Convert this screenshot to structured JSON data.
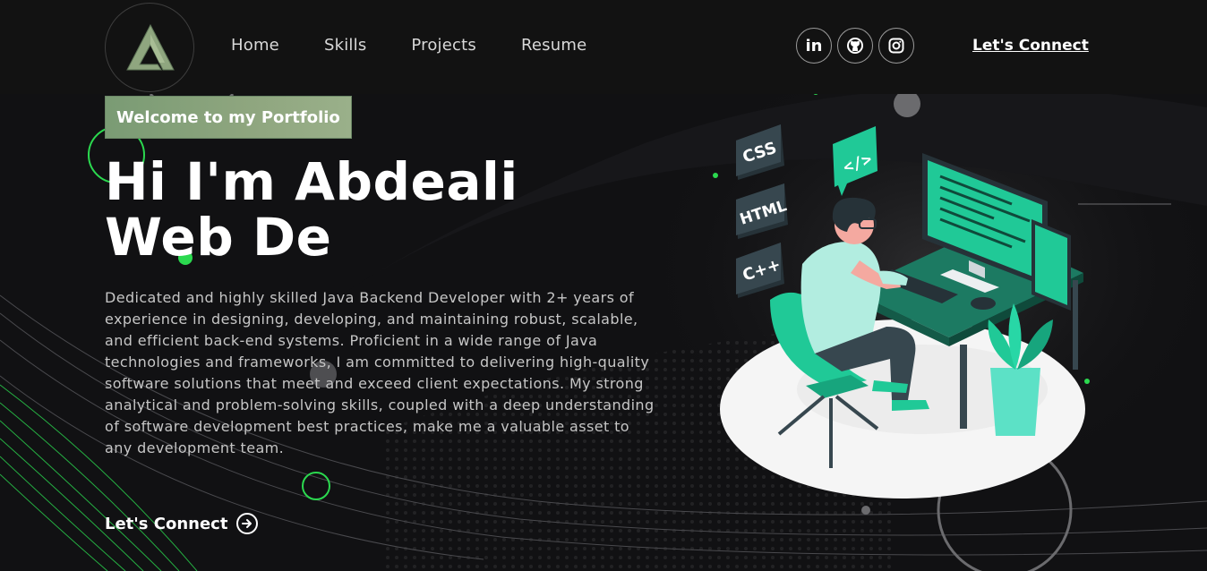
{
  "brand": {
    "logo_icon": "triangle-a-logo-icon"
  },
  "nav": {
    "links": [
      "Home",
      "Skills",
      "Projects",
      "Resume"
    ],
    "social": [
      {
        "label": "in",
        "icon": "linkedin-icon"
      },
      {
        "label": "",
        "icon": "github-icon"
      },
      {
        "label": "",
        "icon": "instagram-icon"
      }
    ],
    "cta": "Let's Connect"
  },
  "hero": {
    "tagline": "Welcome to my Portfolio",
    "headline_line1": "Hi I'm Abdeali",
    "headline_line2": "Web De",
    "description": "Dedicated and highly skilled Java Backend Developer with 2+ years of experience in designing, developing, and maintaining robust, scalable, and efficient back-end systems. Proficient in a wide range of Java technologies and frameworks, I am committed to delivering high-quality software solutions that meet and exceed client expectations. My strong analytical and problem-solving skills, coupled with a deep understanding of software development best practices, make me a valuable asset to any development team.",
    "cta": "Let's Connect",
    "cta_icon": "arrow-right-circle-icon"
  },
  "illustration": {
    "badges": [
      "CSS",
      "HTML",
      "C++"
    ],
    "code_badge": "</>"
  },
  "colors": {
    "accent_green": "#20c997",
    "tag_green": "#8aa37c",
    "dot_green": "#2bd94f",
    "background": "#111113"
  }
}
